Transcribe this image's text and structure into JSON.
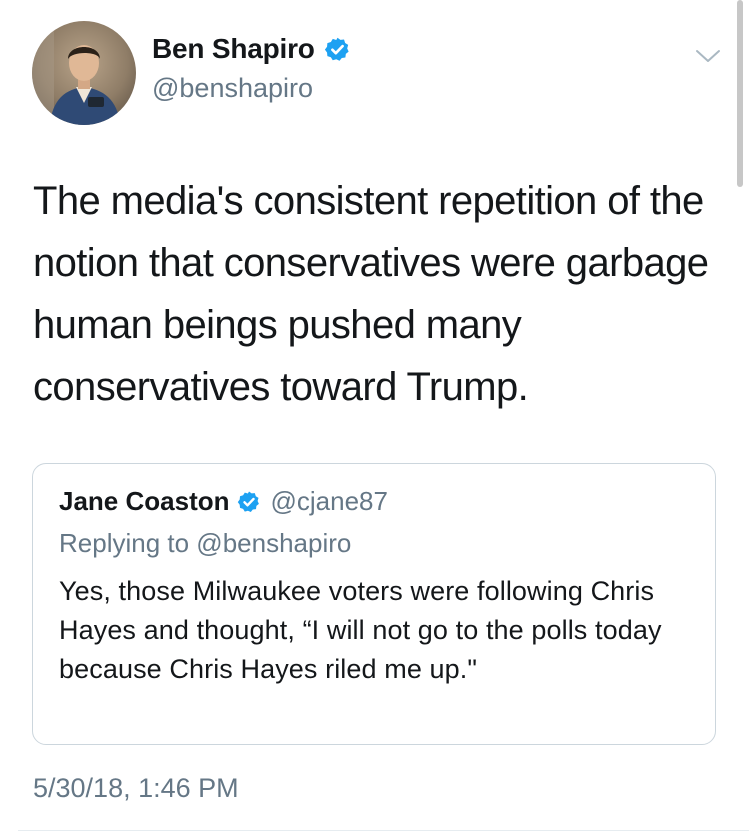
{
  "tweet": {
    "author": {
      "name": "Ben Shapiro",
      "handle": "@benshapiro",
      "verified": true,
      "avatar_icon": "profile-photo"
    },
    "text": "The media's consistent repetition of the notion that conservatives were garbage human beings pushed many conservatives toward Trump.",
    "timestamp": "5/30/18, 1:46 PM",
    "menu_icon": "chevron-down-icon"
  },
  "quoted_tweet": {
    "author": {
      "name": "Jane Coaston",
      "handle": "@cjane87",
      "verified": true
    },
    "replying_to": "Replying to @benshapiro",
    "text": "Yes, those Milwaukee voters were following Chris Hayes and thought, “I will not go to the polls today because Chris Hayes riled me up.\""
  },
  "colors": {
    "verified_blue": "#1da1f2",
    "secondary_text": "#657786",
    "primary_text": "#14171a",
    "border": "#ccd6dd"
  }
}
